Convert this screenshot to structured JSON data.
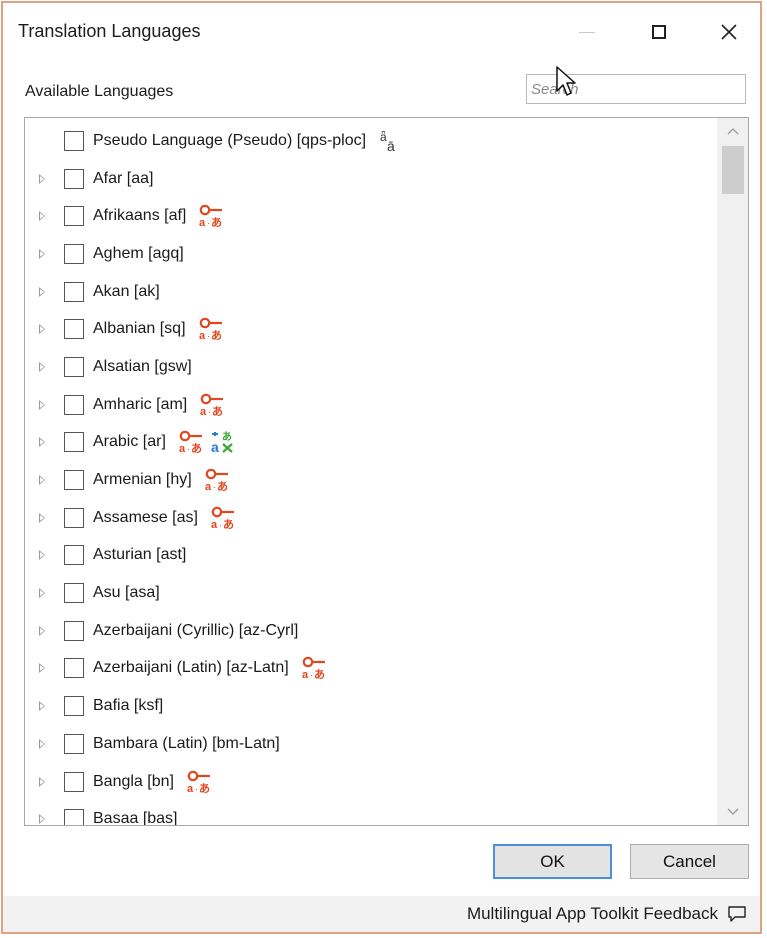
{
  "window": {
    "title": "Translation Languages",
    "controls": [
      "minimize",
      "maximize",
      "close"
    ]
  },
  "available_label": "Available Languages",
  "search": {
    "placeholder": "Search",
    "value": ""
  },
  "languages": [
    {
      "label": "Pseudo Language (Pseudo) [qps-ploc]",
      "expandable": false,
      "icons": [
        "pseudo-translate-icon"
      ]
    },
    {
      "label": "Afar [aa]",
      "expandable": true,
      "icons": []
    },
    {
      "label": "Afrikaans [af]",
      "expandable": true,
      "icons": [
        "machine-translation-icon"
      ]
    },
    {
      "label": "Aghem [agq]",
      "expandable": true,
      "icons": []
    },
    {
      "label": "Akan [ak]",
      "expandable": true,
      "icons": []
    },
    {
      "label": "Albanian [sq]",
      "expandable": true,
      "icons": [
        "machine-translation-icon"
      ]
    },
    {
      "label": "Alsatian [gsw]",
      "expandable": true,
      "icons": []
    },
    {
      "label": "Amharic [am]",
      "expandable": true,
      "icons": [
        "machine-translation-icon"
      ]
    },
    {
      "label": "Arabic [ar]",
      "expandable": true,
      "icons": [
        "machine-translation-icon",
        "translator-icon"
      ]
    },
    {
      "label": "Armenian [hy]",
      "expandable": true,
      "icons": [
        "machine-translation-icon"
      ]
    },
    {
      "label": "Assamese [as]",
      "expandable": true,
      "icons": [
        "machine-translation-icon"
      ]
    },
    {
      "label": "Asturian [ast]",
      "expandable": true,
      "icons": []
    },
    {
      "label": "Asu [asa]",
      "expandable": true,
      "icons": []
    },
    {
      "label": "Azerbaijani (Cyrillic) [az-Cyrl]",
      "expandable": true,
      "icons": []
    },
    {
      "label": "Azerbaijani (Latin) [az-Latn]",
      "expandable": true,
      "icons": [
        "machine-translation-icon"
      ]
    },
    {
      "label": "Bafia [ksf]",
      "expandable": true,
      "icons": []
    },
    {
      "label": "Bambara (Latin) [bm-Latn]",
      "expandable": true,
      "icons": []
    },
    {
      "label": "Bangla [bn]",
      "expandable": true,
      "icons": [
        "machine-translation-icon"
      ]
    },
    {
      "label": "Basaa [bas]",
      "expandable": true,
      "icons": []
    }
  ],
  "buttons": {
    "ok": "OK",
    "cancel": "Cancel"
  },
  "footer": {
    "feedback_label": "Multilingual App Toolkit Feedback"
  },
  "colors": {
    "mt_icon": "#e2461c",
    "translator_icon_blue": "#2b7bd6",
    "translator_icon_green": "#3aa832",
    "ok_border": "#4a90d9",
    "window_border": "#e0a184"
  }
}
